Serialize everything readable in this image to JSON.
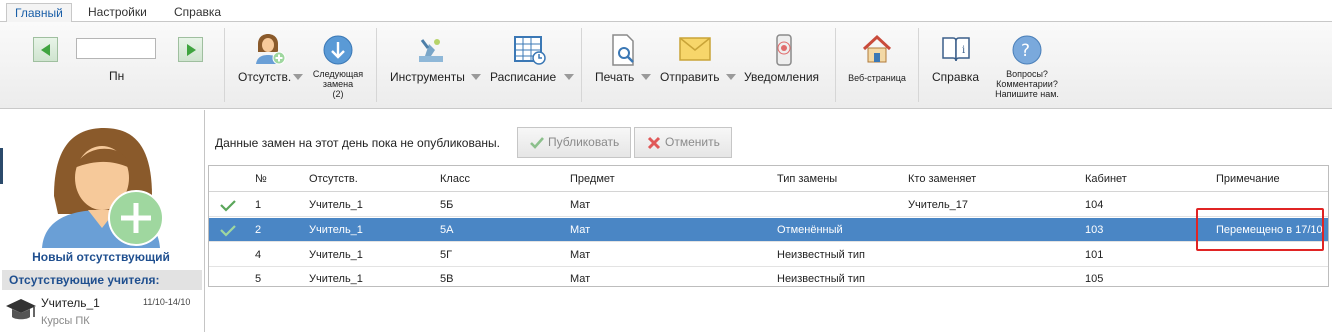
{
  "tabs": [
    "Главный",
    "Настройки",
    "Справка"
  ],
  "ribbon": {
    "day_label": "Пн",
    "absence_label": "Отсутств.",
    "next_sub_label": "Следующая\nзамена\n(2)",
    "tools_label": "Инструменты",
    "schedule_label": "Расписание",
    "print_label": "Печать",
    "send_label": "Отправить",
    "notify_label": "Уведомления",
    "web_label": "Веб-страница",
    "help_label": "Справка",
    "questions_label": "Вопросы?\nКомментарии?\nНапишите нам."
  },
  "left": {
    "new_absent_label": "Новый отсутствующий",
    "absent_header": "Отсутствующие учителя:",
    "absent_teacher": {
      "name": "Учитель_1",
      "dates": "11/10-14/10",
      "reason": "Курсы ПК"
    }
  },
  "info": {
    "message": "Данные замен на этот день пока не опубликованы.",
    "publish_label": "Публиковать",
    "cancel_label": "Отменить"
  },
  "table": {
    "headers": [
      "№",
      "Отсутств.",
      "Класс",
      "Предмет",
      "Тип замены",
      "Кто заменяет",
      "Кабинет",
      "Примечание"
    ],
    "rows": [
      {
        "check": true,
        "num": "1",
        "absent": "Учитель_1",
        "class": "5Б",
        "subject": "Мат",
        "type": "",
        "who": "Учитель_17",
        "room": "104",
        "note": ""
      },
      {
        "check": true,
        "num": "2",
        "absent": "Учитель_1",
        "class": "5А",
        "subject": "Мат",
        "type": "Отменённый",
        "who": "",
        "room": "103",
        "note": "Перемещено в 17/10"
      },
      {
        "check": false,
        "num": "4",
        "absent": "Учитель_1",
        "class": "5Г",
        "subject": "Мат",
        "type": "Неизвестный тип",
        "who": "",
        "room": "101",
        "note": ""
      },
      {
        "check": false,
        "num": "5",
        "absent": "Учитель_1",
        "class": "5В",
        "subject": "Мат",
        "type": "Неизвестный тип",
        "who": "",
        "room": "105",
        "note": ""
      }
    ]
  },
  "colors": {
    "accent": "#1f4f8f",
    "selected_row": "#4a86c5",
    "highlight": "#e02424",
    "check": "#5aa65a"
  }
}
